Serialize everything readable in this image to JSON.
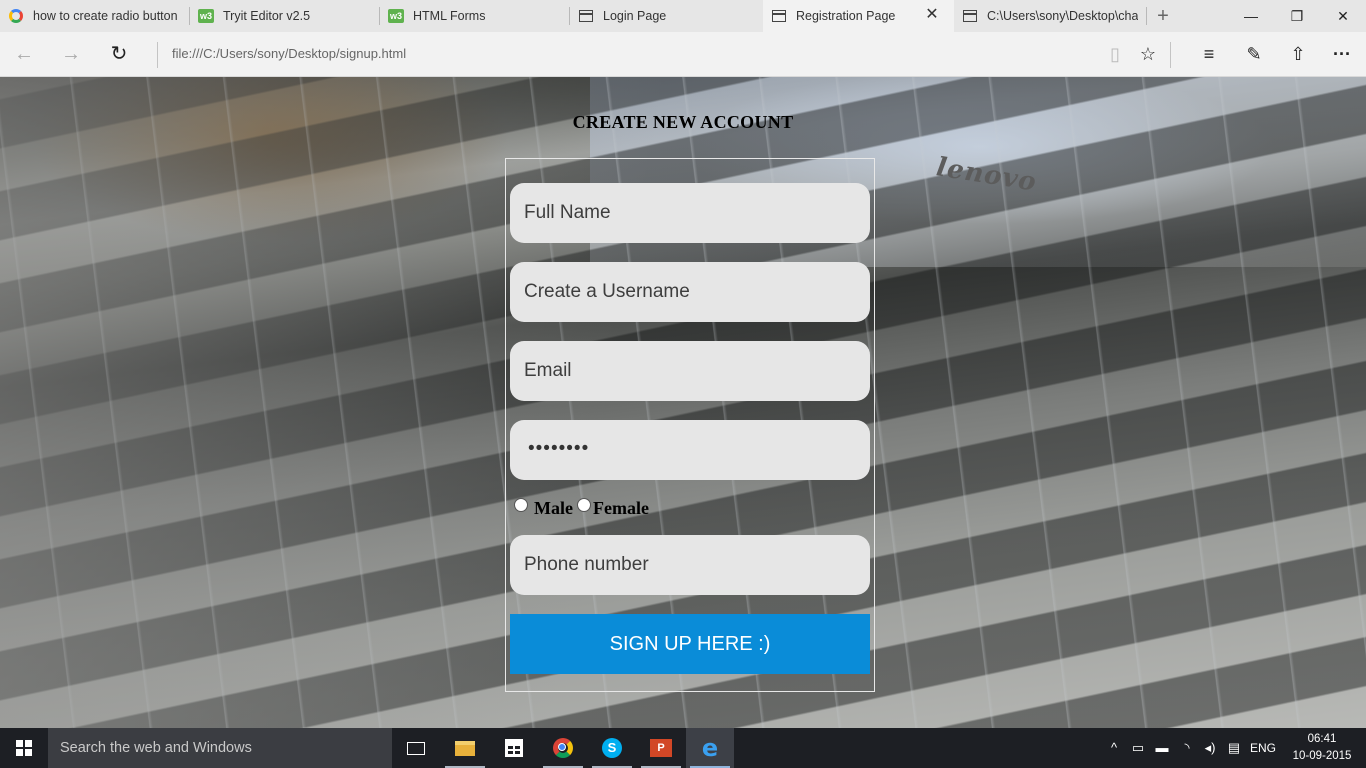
{
  "browser": {
    "tabs": [
      {
        "label": "how to create radio button",
        "icon": "google-icon",
        "active": false
      },
      {
        "label": "Tryit Editor v2.5",
        "icon": "w3schools-icon",
        "active": false
      },
      {
        "label": "HTML Forms",
        "icon": "w3schools-icon",
        "active": false
      },
      {
        "label": "Login Page",
        "icon": "page-icon",
        "active": false
      },
      {
        "label": "Registration Page",
        "icon": "page-icon",
        "active": true
      },
      {
        "label": "C:\\Users\\sony\\Desktop\\cha",
        "icon": "page-icon",
        "active": false
      }
    ],
    "w3_icon_text": "w3",
    "close_glyph": "✕",
    "new_tab_glyph": "+",
    "window_controls": {
      "minimize": "—",
      "restore": "❐",
      "close": "✕"
    },
    "address": "file:///C:/Users/sony/Desktop/signup.html",
    "nav": {
      "back": "←",
      "forward": "→",
      "refresh": "↻"
    },
    "toolbar": {
      "reading_view": "▯",
      "favorite": "☆",
      "hub": "≡",
      "web_note": "✎",
      "share": "⇧",
      "more": "···"
    }
  },
  "page": {
    "brand_logo_text": "lenovo",
    "title": "CREATE NEW ACCOUNT",
    "fields": {
      "full_name": {
        "placeholder": "Full Name",
        "value": ""
      },
      "username": {
        "placeholder": "Create a Username",
        "value": ""
      },
      "email": {
        "placeholder": "Email",
        "value": ""
      },
      "password": {
        "masked_value": "••••••••"
      },
      "phone": {
        "placeholder": "Phone number",
        "value": ""
      }
    },
    "gender": {
      "options": [
        "Male",
        "Female"
      ],
      "selected": null
    },
    "submit_label": "SIGN UP HERE :)",
    "submit_color": "#0a8cd8"
  },
  "taskbar": {
    "search_placeholder": "Search the web and Windows",
    "apps": [
      "task-view-icon",
      "file-explorer-icon",
      "store-icon",
      "chrome-icon",
      "skype-icon",
      "powerpoint-icon",
      "edge-icon"
    ],
    "skype_letter": "S",
    "ppt_letter": "P",
    "edge_letter": "e",
    "tray": {
      "chevron": "^",
      "language": "ENG"
    },
    "time": "06:41",
    "date": "10-09-2015"
  }
}
